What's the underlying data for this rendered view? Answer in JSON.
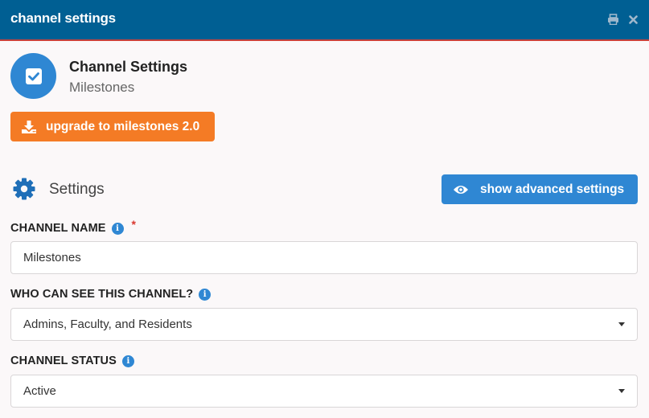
{
  "window": {
    "title": "channel settings",
    "print_icon": "print-icon",
    "close_icon": "close-icon"
  },
  "header": {
    "icon": "checkbox-icon",
    "title": "Channel Settings",
    "subtitle": "Milestones"
  },
  "upgrade_button": {
    "icon": "download-icon",
    "label": "upgrade to milestones 2.0"
  },
  "settings": {
    "icon": "gear-icon",
    "label": "Settings",
    "advanced_button": {
      "icon": "eye-icon",
      "label": "show advanced settings"
    }
  },
  "fields": {
    "channel_name": {
      "label": "CHANNEL NAME",
      "required_marker": "*",
      "value": "Milestones"
    },
    "visibility": {
      "label": "WHO CAN SEE THIS CHANNEL?",
      "value": "Admins, Faculty, and Residents"
    },
    "status": {
      "label": "CHANNEL STATUS",
      "value": "Active"
    }
  },
  "colors": {
    "titlebar": "#005f93",
    "accent_blue": "#2f87d3",
    "upgrade_orange": "#f47b25",
    "required_red": "#d9372f"
  }
}
